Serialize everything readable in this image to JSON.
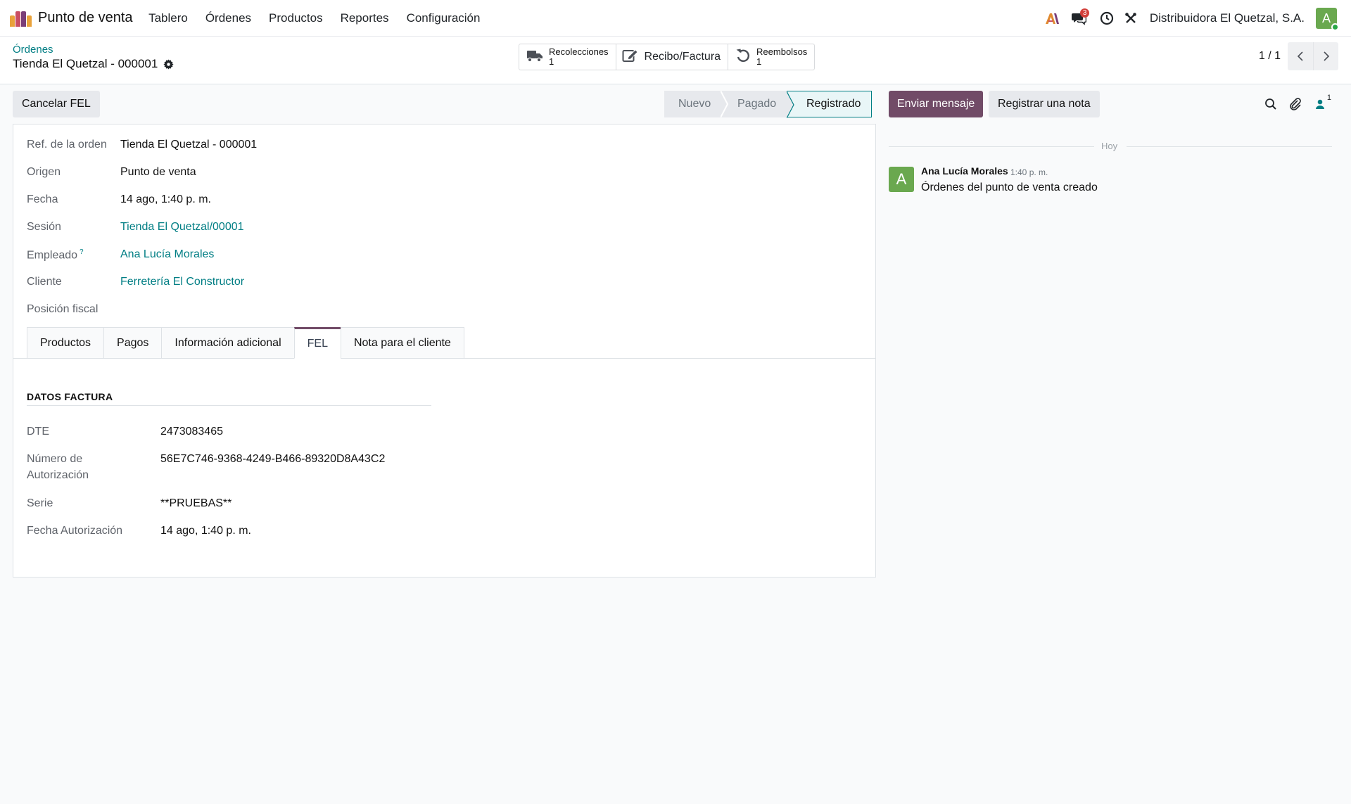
{
  "app": {
    "name": "Punto de venta",
    "logo_colors": [
      "#e9a23b",
      "#c94e63",
      "#7a3e78",
      "#e9a23b"
    ]
  },
  "menu": [
    "Tablero",
    "Órdenes",
    "Productos",
    "Reportes",
    "Configuración"
  ],
  "navbar": {
    "messages_badge": "3",
    "company": "Distribuidora El Quetzal, S.A.",
    "user_initial": "A",
    "icons": [
      "ai-icon",
      "chat-icon",
      "clock-icon",
      "tools-icon"
    ]
  },
  "control": {
    "breadcrumb": "Órdenes",
    "record_title": "Tienda El Quetzal - 000001",
    "smart_buttons": [
      {
        "label": "Recolecciones",
        "count": "1",
        "icon": "truck-icon"
      },
      {
        "label": "Recibo/Factura",
        "count": "",
        "icon": "edit-icon"
      },
      {
        "label": "Reembolsos",
        "count": "1",
        "icon": "undo-icon"
      }
    ],
    "pager": "1 / 1"
  },
  "actions": {
    "cancel_fel": "Cancelar FEL"
  },
  "statusbar": {
    "stages": [
      "Nuevo",
      "Pagado",
      "Registrado"
    ],
    "current": "Registrado"
  },
  "form": {
    "fields": [
      {
        "label": "Ref. de la orden",
        "value": "Tienda El Quetzal - 000001",
        "kind": "text"
      },
      {
        "label": "Origen",
        "value": "Punto de venta",
        "kind": "text"
      },
      {
        "label": "Fecha",
        "value": "14 ago, 1:40 p. m.",
        "kind": "text"
      },
      {
        "label": "Sesión",
        "value": "Tienda El Quetzal/00001",
        "kind": "link"
      },
      {
        "label": "Empleado",
        "value": "Ana Lucía Morales",
        "kind": "link",
        "help": "?"
      },
      {
        "label": "Cliente",
        "value": "Ferretería El Constructor",
        "kind": "link"
      },
      {
        "label": "Posición fiscal",
        "value": "",
        "kind": "text"
      }
    ],
    "tabs": [
      "Productos",
      "Pagos",
      "Información adicional",
      "FEL",
      "Nota para el cliente"
    ],
    "active_tab": "FEL",
    "fel": {
      "group_title": "DATOS FACTURA",
      "dte_label": "DTE",
      "dte_value": "2473083465",
      "auth_label_1": "Número de",
      "auth_label_2": "Autorización",
      "auth_value": "56E7C746-9368-4249-B466-89320D8A43C2",
      "serie_label": "Serie",
      "serie_value": "**PRUEBAS**",
      "auth_date_label": "Fecha Autorización",
      "auth_date_value": "14 ago, 1:40 p. m."
    }
  },
  "chatter": {
    "send_message": "Enviar mensaje",
    "log_note": "Registrar una nota",
    "followers_count": "1",
    "day_separator": "Hoy",
    "message": {
      "avatar_initial": "A",
      "author": "Ana Lucía Morales",
      "time": "1:40 p. m.",
      "body": "Órdenes del punto de venta creado"
    }
  },
  "colors": {
    "primary": "#714b67",
    "link": "#017e84",
    "avatar": "#6aa84f",
    "badge": "#d23f3a"
  }
}
